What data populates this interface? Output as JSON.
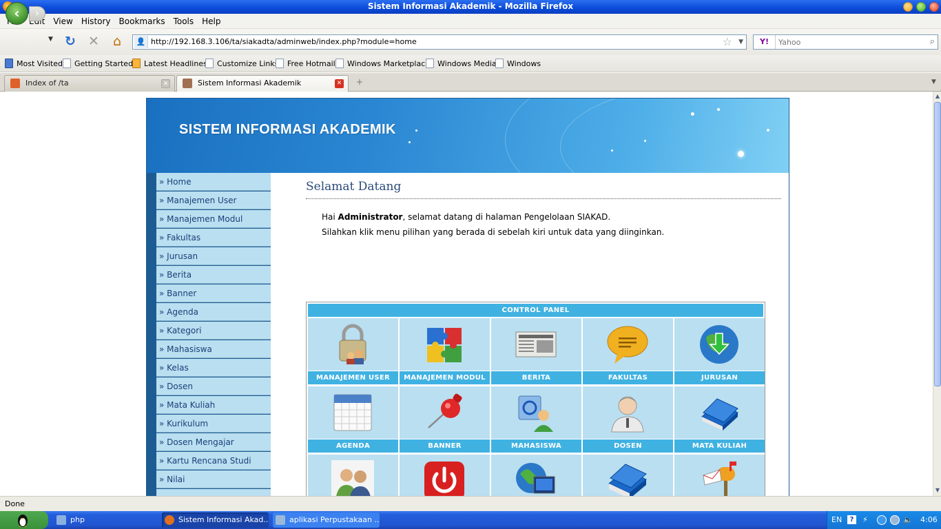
{
  "window": {
    "title": "Sistem Informasi Akademik - Mozilla Firefox"
  },
  "menu": [
    "File",
    "Edit",
    "View",
    "History",
    "Bookmarks",
    "Tools",
    "Help"
  ],
  "nav": {
    "url": "http://192.168.3.106/ta/siakadta/adminweb/index.php?module=home",
    "search_placeholder": "Yahoo",
    "search_engine": "Y!"
  },
  "bookmarks": [
    "Most Visited",
    "Getting Started",
    "Latest Headlines",
    "Customize Links",
    "Free Hotmail",
    "Windows Marketplace",
    "Windows Media",
    "Windows"
  ],
  "tabs": [
    {
      "label": "Index of /ta",
      "active": false
    },
    {
      "label": "Sistem Informasi Akademik",
      "active": true
    }
  ],
  "page": {
    "banner_title": "SISTEM INFORMASI AKADEMIK",
    "menu": [
      "» Home",
      "» Manajemen User",
      "» Manajemen Modul",
      "» Fakultas",
      "» Jurusan",
      "» Berita",
      "» Banner",
      "» Agenda",
      "» Kategori",
      "» Mahasiswa",
      "» Kelas",
      "» Dosen",
      "» Mata Kuliah",
      "» Kurikulum",
      "» Dosen Mengajar",
      "» Kartu Rencana Studi",
      "» Nilai"
    ],
    "heading": "Selamat Datang",
    "greeting_prefix": "Hai ",
    "greeting_user": "Administrator",
    "greeting_suffix": ", selamat datang di halaman Pengelolaan SIAKAD.",
    "instruction": "Silahkan klik menu pilihan yang berada di sebelah kiri untuk data yang diinginkan.",
    "control_panel": {
      "title": "CONTROL PANEL",
      "items": [
        {
          "label": "MANAJEMEN USER",
          "icon": "padlock-users-icon"
        },
        {
          "label": "MANAJEMEN MODUL",
          "icon": "puzzle-icon"
        },
        {
          "label": "BERITA",
          "icon": "newspaper-icon"
        },
        {
          "label": "FAKULTAS",
          "icon": "speech-bubble-icon"
        },
        {
          "label": "JURUSAN",
          "icon": "globe-download-icon"
        },
        {
          "label": "AGENDA",
          "icon": "calendar-icon"
        },
        {
          "label": "BANNER",
          "icon": "pushpin-icon"
        },
        {
          "label": "MAHASISWA",
          "icon": "user-sync-icon"
        },
        {
          "label": "DOSEN",
          "icon": "teacher-icon"
        },
        {
          "label": "MATA KULIAH",
          "icon": "book-icon"
        },
        {
          "label": "",
          "icon": "people-icon"
        },
        {
          "label": "",
          "icon": "power-icon"
        },
        {
          "label": "",
          "icon": "globe-monitor-icon"
        },
        {
          "label": "",
          "icon": "books-icon"
        },
        {
          "label": "",
          "icon": "mailbox-icon"
        }
      ]
    }
  },
  "status": "Done",
  "taskbar": {
    "items": [
      "php",
      "Sistem Informasi Akad...",
      "aplikasi Perpustakaan ..."
    ],
    "lang": "EN",
    "time": "4:06"
  }
}
